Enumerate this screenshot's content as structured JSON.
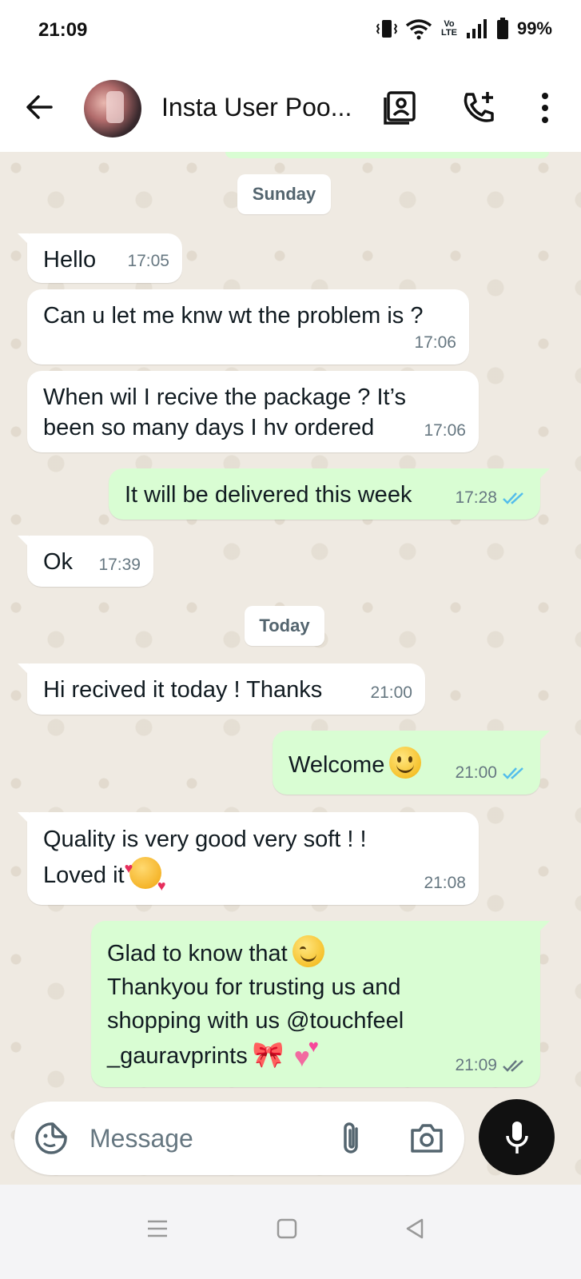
{
  "status_bar": {
    "time": "21:09",
    "battery": "99%",
    "volte_label": "Vo LTE"
  },
  "header": {
    "contact_name": "Insta User Poo..."
  },
  "chat": {
    "date_chips": [
      "Sunday",
      "Today"
    ],
    "messages": [
      {
        "direction": "in",
        "text": "Hello",
        "time": "17:05"
      },
      {
        "direction": "in",
        "text": "Can u let me knw wt the problem is ?",
        "time": "17:06"
      },
      {
        "direction": "in",
        "text": "When wil I recive the package ? It’s\nbeen so many days I hv ordered",
        "time": "17:06"
      },
      {
        "direction": "out",
        "text": "It will be delivered this week",
        "time": "17:28",
        "status": "read"
      },
      {
        "direction": "in",
        "text": "Ok",
        "time": "17:39"
      },
      {
        "direction": "in",
        "text": "Hi recived it today ! Thanks",
        "time": "21:00"
      },
      {
        "direction": "out",
        "text": "Welcome",
        "emoji": "slightly-smiling-face",
        "time": "21:00",
        "status": "read"
      },
      {
        "direction": "in",
        "text_line1": "Quality is very good very soft ! !",
        "text_line2": "Loved it",
        "emoji": "smiling-face-with-hearts",
        "time": "21:08"
      },
      {
        "direction": "out",
        "text_line1": "Glad to know that",
        "text_line2": "Thankyou for trusting us and",
        "text_line3": "shopping with us @touchfeel",
        "text_line4": "_gauravprints",
        "emoji": [
          "smiling-face-with-smiling-eyes",
          "ribbon",
          "two-hearts"
        ],
        "time": "21:09",
        "status": "delivered"
      }
    ]
  },
  "input": {
    "placeholder": "Message"
  },
  "colors": {
    "chat_background": "#efeae2",
    "incoming_bubble": "#ffffff",
    "outgoing_bubble": "#d9fdd3",
    "read_tick": "#53bdeb",
    "delivered_tick": "#667781",
    "mic_button": "#111111"
  },
  "icons": {
    "header": [
      "back-arrow-icon",
      "contact-card-icon",
      "add-call-icon",
      "more-vert-icon"
    ],
    "input": [
      "sticker-icon",
      "attach-icon",
      "camera-icon",
      "mic-icon"
    ],
    "nav": [
      "nav-menu-icon",
      "nav-home-icon",
      "nav-back-icon"
    ]
  }
}
